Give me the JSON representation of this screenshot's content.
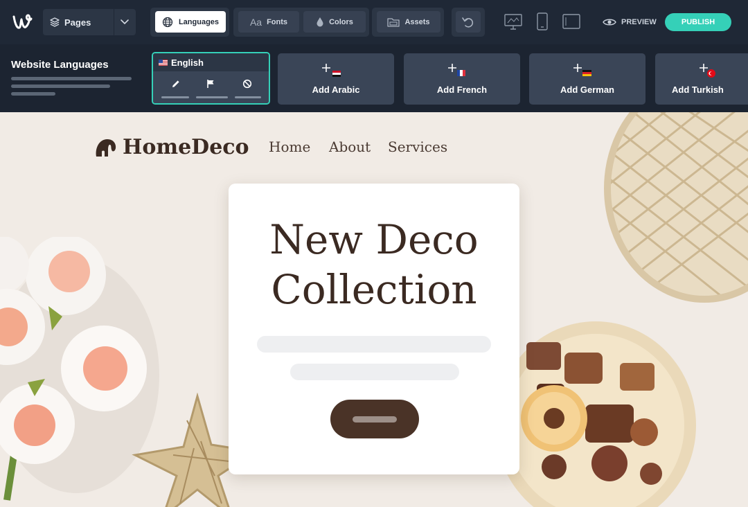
{
  "toolbar": {
    "pages_label": "Pages",
    "languages_label": "Languages",
    "fonts_label": "Fonts",
    "fonts_icon_text": "Aa",
    "colors_label": "Colors",
    "assets_label": "Assets",
    "preview_label": "PREVIEW",
    "publish_label": "PUBLISH",
    "accent_color": "#35d0b8"
  },
  "languages_panel": {
    "title": "Website Languages",
    "current": {
      "name": "English",
      "flag": "us-flag-icon"
    },
    "add_buttons": [
      {
        "label": "Add Arabic",
        "flag": "egypt-flag-icon"
      },
      {
        "label": "Add French",
        "flag": "france-flag-icon"
      },
      {
        "label": "Add German",
        "flag": "germany-flag-icon"
      },
      {
        "label": "Add Turkish",
        "flag": "turkey-flag-icon"
      }
    ]
  },
  "website": {
    "brand_name": "HomeDeco",
    "nav": [
      "Home",
      "About",
      "Services"
    ],
    "hero_title_line1": "New Deco",
    "hero_title_line2": "Collection"
  }
}
